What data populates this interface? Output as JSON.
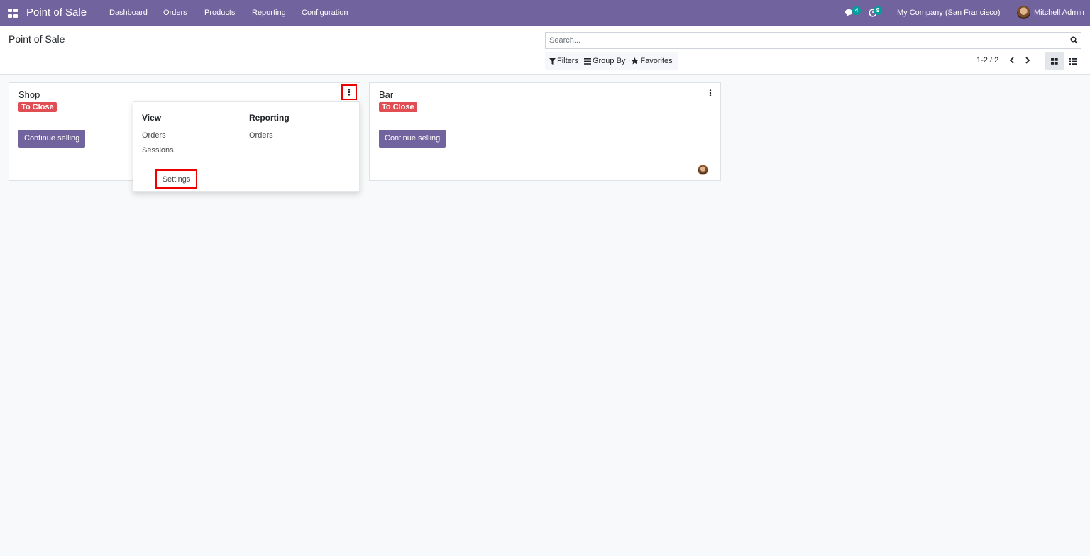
{
  "navbar": {
    "app_title": "Point of Sale",
    "menu": [
      "Dashboard",
      "Orders",
      "Products",
      "Reporting",
      "Configuration"
    ],
    "messages_count": "4",
    "activities_count": "9",
    "company": "My Company (San Francisco)",
    "user": "Mitchell Admin"
  },
  "control_panel": {
    "title": "Point of Sale",
    "search_placeholder": "Search...",
    "filters": "Filters",
    "group_by": "Group By",
    "favorites": "Favorites",
    "pager": "1-2 / 2"
  },
  "cards": [
    {
      "name": "Shop",
      "status": "To Close",
      "action": "Continue selling"
    },
    {
      "name": "Bar",
      "status": "To Close",
      "action": "Continue selling"
    }
  ],
  "dropdown": {
    "view_heading": "View",
    "view_items": [
      "Orders",
      "Sessions"
    ],
    "reporting_heading": "Reporting",
    "reporting_items": [
      "Orders"
    ],
    "settings": "Settings"
  },
  "colors": {
    "brand": "#71639e",
    "status_red": "#e04e53",
    "badge_teal": "#00a09d",
    "highlight_red": "#ee0000"
  }
}
